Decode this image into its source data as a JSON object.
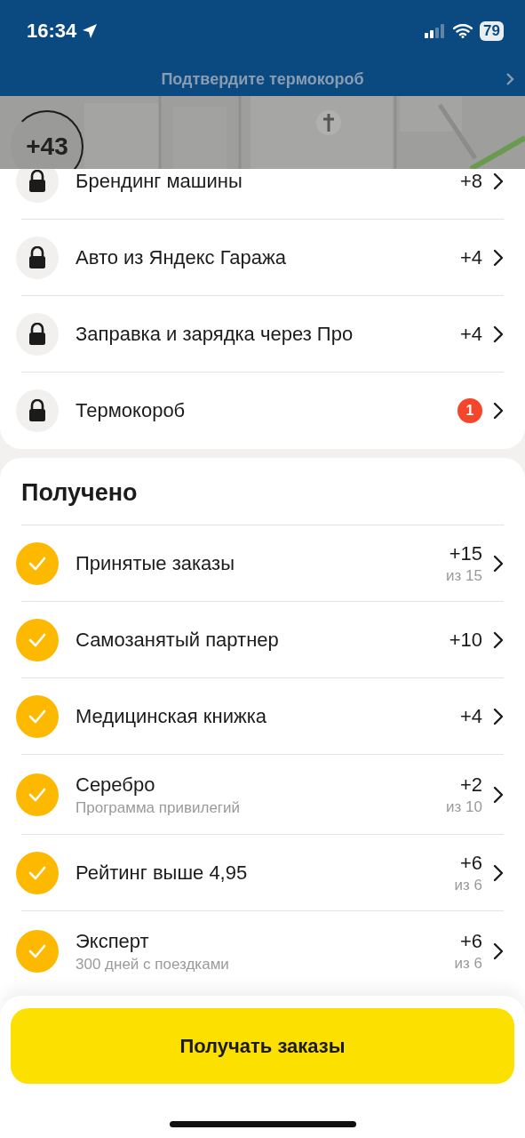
{
  "status_bar": {
    "time": "16:34",
    "battery": "79"
  },
  "banner": {
    "text": "Подтвердите термокороб"
  },
  "map": {
    "kind": "picture",
    "score": "+43"
  },
  "locked": [
    {
      "title": "Брендинг машины",
      "points": "+8"
    },
    {
      "title": "Авто из Яндекс Гаража",
      "points": "+4"
    },
    {
      "title": "Заправка и зарядка через Про",
      "points": "+4"
    },
    {
      "title": "Термокороб",
      "badge": "1"
    }
  ],
  "received": {
    "heading": "Получено",
    "items": [
      {
        "title": "Принятые заказы",
        "points": "+15",
        "of": "из 15"
      },
      {
        "title": "Самозанятый партнер",
        "points": "+10"
      },
      {
        "title": "Медицинская книжка",
        "points": "+4"
      },
      {
        "title": "Серебро",
        "subtitle": "Программа привилегий",
        "points": "+2",
        "of": "из 10"
      },
      {
        "title": "Рейтинг выше 4,95",
        "points": "+6",
        "of": "из 6"
      },
      {
        "title": "Эксперт",
        "subtitle": "300 дней с поездками",
        "points": "+6",
        "of": "из 6"
      }
    ]
  },
  "action_button": "Получать заказы"
}
